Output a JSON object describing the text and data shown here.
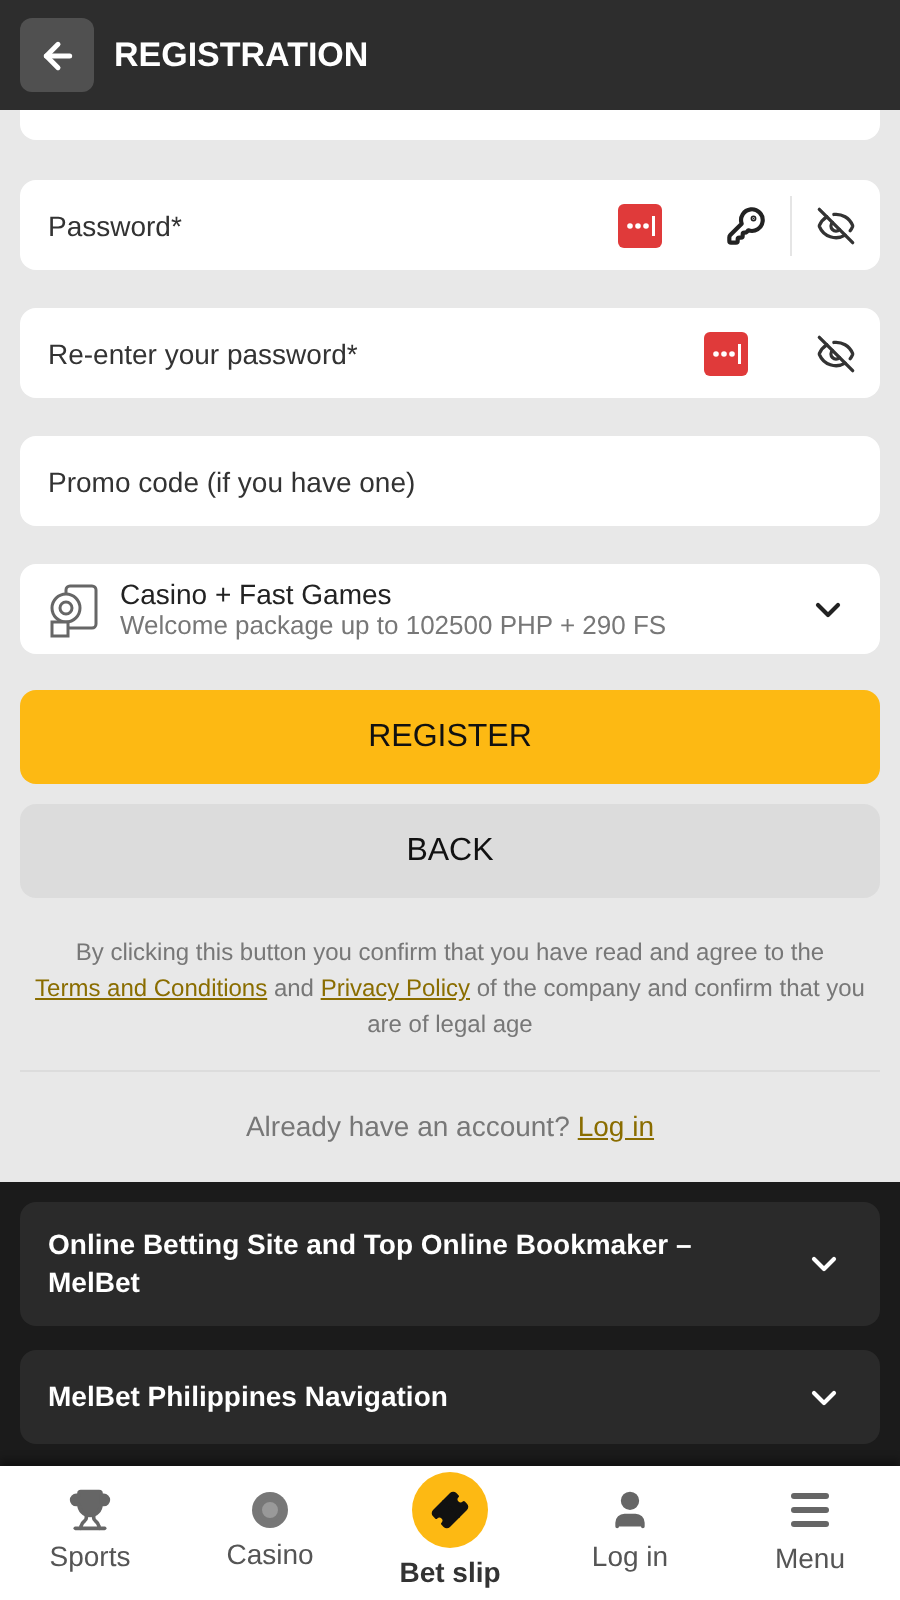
{
  "header": {
    "title": "REGISTRATION"
  },
  "fields": [
    {
      "kind": "password",
      "placeholder": "Password*",
      "generator": true
    },
    {
      "kind": "password",
      "placeholder": "Re-enter your password*",
      "generator": false
    },
    {
      "kind": "text",
      "placeholder": "Promo code (if you have one)"
    }
  ],
  "bonus": {
    "title": "Casino + Fast Games",
    "subtitle": "Welcome package up to 102500 PHP + 290 FS"
  },
  "buttons": {
    "register": "REGISTER",
    "back": "BACK"
  },
  "disclaimer": {
    "before": "By clicking this button you confirm that you have read and agree to the",
    "link1": "Terms and Conditions",
    "middle": "and",
    "link2": "Privacy Policy",
    "after": "of the company and confirm that you are of legal age"
  },
  "login_prompt": {
    "text": "Already have an account?",
    "link": "Log in"
  },
  "accordions": [
    {
      "title": "Online Betting Site and Top Online Bookmaker – MelBet",
      "expanded": false
    },
    {
      "title": "MelBet Philippines Navigation",
      "expanded": false
    }
  ],
  "nav": [
    {
      "kind": "sports",
      "label": "Sports",
      "selected": false
    },
    {
      "kind": "casino",
      "label": "Casino",
      "selected": false
    },
    {
      "kind": "betslip",
      "label": "Bet slip",
      "selected": true
    },
    {
      "kind": "login",
      "label": "Log in",
      "selected": false
    },
    {
      "kind": "menu",
      "label": "Menu",
      "selected": false
    }
  ]
}
